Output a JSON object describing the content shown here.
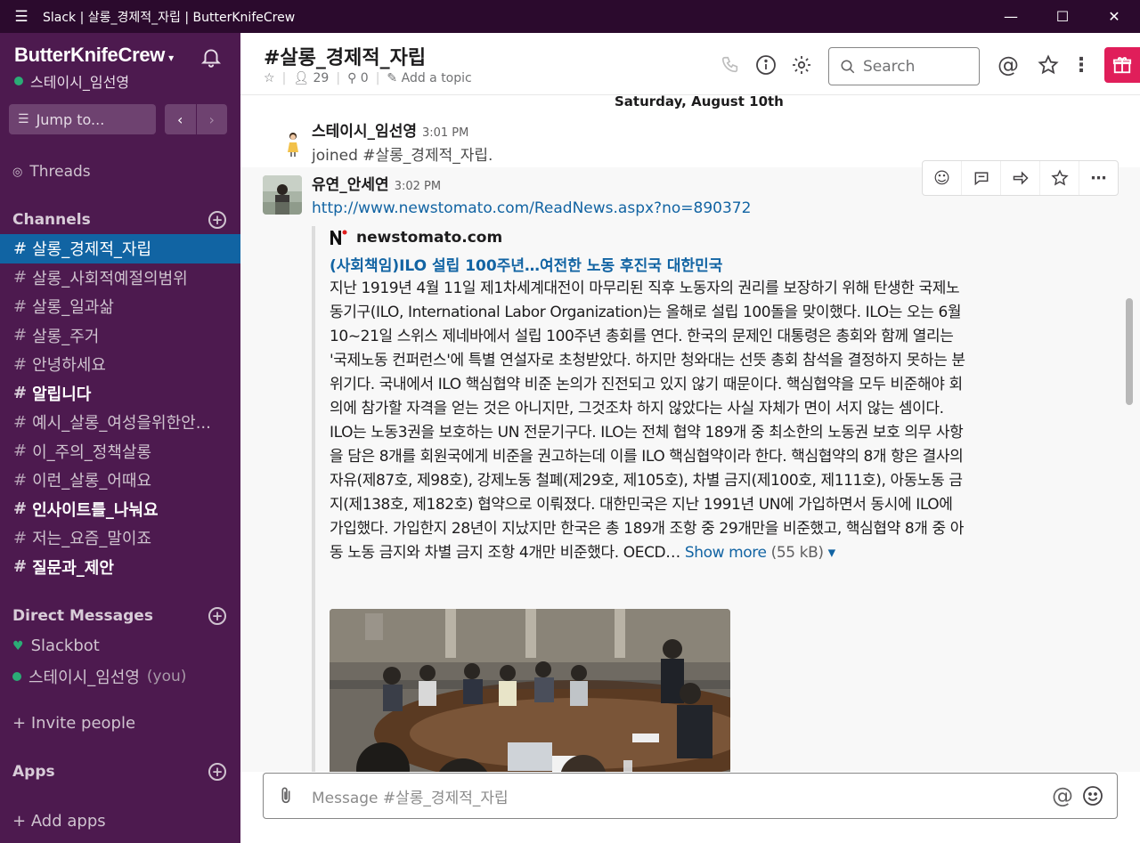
{
  "window": {
    "title": "Slack | 살롱_경제적_자립 | ButterKnifeCrew"
  },
  "sidebar": {
    "workspace_name": "ButterKnifeCrew",
    "current_user": "스테이시_임선영",
    "jump_to": "Jump to...",
    "threads": "Threads",
    "channels_header": "Channels",
    "channels": [
      {
        "name": "살롱_경제적_자립",
        "state": "active"
      },
      {
        "name": "살롱_사회적예절의범위",
        "state": "normal"
      },
      {
        "name": "살롱_일과삶",
        "state": "normal"
      },
      {
        "name": "살롱_주거",
        "state": "normal"
      },
      {
        "name": "안녕하세요",
        "state": "normal"
      },
      {
        "name": "알립니다",
        "state": "unread"
      },
      {
        "name": "예시_살롱_여성을위한안...",
        "state": "normal"
      },
      {
        "name": "이_주의_정책살롱",
        "state": "normal"
      },
      {
        "name": "이런_살롱_어때요",
        "state": "normal"
      },
      {
        "name": "인사이트를_나눠요",
        "state": "unread"
      },
      {
        "name": "저는_요즘_말이죠",
        "state": "normal"
      },
      {
        "name": "질문과_제안",
        "state": "unread"
      }
    ],
    "dm_header": "Direct Messages",
    "dms": [
      {
        "name": "Slackbot",
        "suffix": ""
      },
      {
        "name": "스테이시_임선영",
        "suffix": "(you)"
      }
    ],
    "invite": "Invite people",
    "apps_header": "Apps",
    "add_apps": "Add apps"
  },
  "header": {
    "channel_title": "#살롱_경제적_자립",
    "member_count": "29",
    "pinned_count": "0",
    "add_topic": "Add a topic",
    "search_placeholder": "Search"
  },
  "messages": {
    "day_divider": "Saturday, August 10th",
    "join": {
      "sender": "스테이시_임선영",
      "time": "3:01 PM",
      "text": "joined #살롱_경제적_자립."
    },
    "post": {
      "sender": "유연_안세연",
      "time": "3:02 PM",
      "link": "http://www.newstomato.com/ReadNews.aspx?no=890372",
      "attachment": {
        "source": "newstomato.com",
        "title": "(사회책임)ILO 설립 100주년…여전한 노동 후진국 대한민국",
        "body": "지난 1919년 4월 11일 제1차세계대전이 마무리된 직후 노동자의 권리를 보장하기 위해 탄생한 국제노동기구(ILO, International Labor Organization)는 올해로 설립 100돌을 맞이했다. ILO는 오는 6월 10~21일 스위스 제네바에서 설립 100주년 총회를 연다. 한국의 문제인 대통령은 총회와 함께 열리는 '국제노동 컨퍼런스'에 특별 연설자로 초청받았다. 하지만 청와대는 선뜻 총회 참석을 결정하지 못하는 분위기다. 국내에서 ILO 핵심협약 비준 논의가 진전되고 있지 않기 때문이다. 핵심협약을 모두 비준해야 회의에 참가할 자격을 얻는 것은 아니지만, 그것조차 하지 않았다는 사실 자체가 면이 서지 않는 셈이다.  ILO는 노동3권을 보호하는 UN 전문기구다. ILO는 전체 협약 189개 중 최소한의 노동권 보호 의무 사항을 담은 8개를 회원국에게 비준을 권고하는데 이를 ILO 핵심협약이라 한다. 핵심협약의 8개 항은 결사의 자유(제87호, 제98호), 강제노동 철폐(제29호, 제105호), 차별 금지(제100호, 제111호), 아동노동 금지(제138호, 제182호) 협약으로 이뤄졌다. 대한민국은 지난 1991년 UN에 가입하면서 동시에 ILO에 가입했다. 가입한지 28년이 지났지만 한국은 총 189개 조항 중 29개만을 비준했고, 핵심협약 8개 중 아동 노동 금지와 차별 금지 조항 4개만 비준했다. OECD…",
        "show_more": "Show more",
        "size": "(55 kB)"
      }
    }
  },
  "composer": {
    "placeholder": "Message #살롱_경제적_자립"
  },
  "colors": {
    "sidebar_bg": "#4d1a4f",
    "titlebar_bg": "#2b0a2d",
    "active_channel": "#1164a3",
    "link": "#1264a3",
    "presence": "#2bac76",
    "gift": "#e01e5a"
  }
}
